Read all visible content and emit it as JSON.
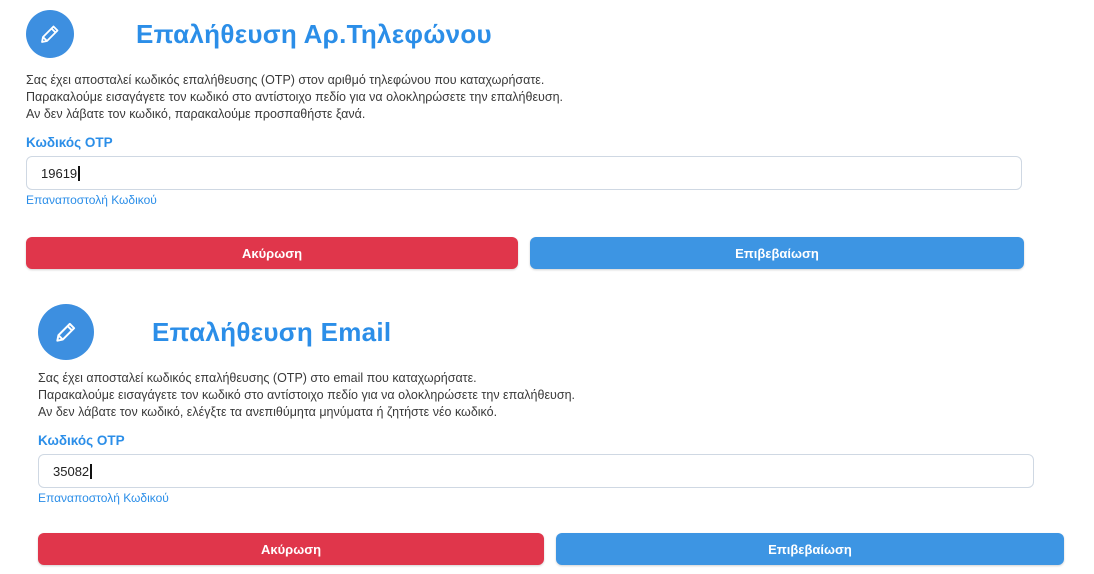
{
  "colors": {
    "accent": "#2b8ee8",
    "cancel": "#e0364b",
    "confirm": "#3d95e3"
  },
  "phone_verification": {
    "icon": "pencil-icon",
    "title": "Επαλήθευση Αρ.Τηλεφώνου",
    "description": [
      "Σας έχει αποσταλεί κωδικός επαλήθευσης (OTP) στον αριθμό τηλεφώνου που καταχωρήσατε.",
      "Παρακαλούμε εισαγάγετε τον κωδικό στο αντίστοιχο πεδίο για να ολοκληρώσετε την επαλήθευση.",
      "Αν δεν λάβατε τον κωδικό, παρακαλούμε προσπαθήστε ξανά."
    ],
    "otp_label": "Κωδικός OTP",
    "otp_value": "19619",
    "resend_label": "Επαναποστολή Κωδικού",
    "cancel_label": "Ακύρωση",
    "confirm_label": "Επιβεβαίωση"
  },
  "email_verification": {
    "icon": "pencil-icon",
    "title": "Επαλήθευση Email",
    "description": [
      "Σας έχει αποσταλεί κωδικός επαλήθευσης (OTP) στο email που καταχωρήσατε.",
      "Παρακαλούμε εισαγάγετε τον κωδικό στο αντίστοιχο πεδίο για να ολοκληρώσετε την επαλήθευση.",
      "Αν δεν λάβατε τον κωδικό, ελέγξτε τα ανεπιθύμητα μηνύματα ή ζητήστε νέο κωδικό."
    ],
    "otp_label": "Κωδικός OTP",
    "otp_value": "35082",
    "resend_label": "Επαναποστολή Κωδικού",
    "cancel_label": "Ακύρωση",
    "confirm_label": "Επιβεβαίωση"
  }
}
